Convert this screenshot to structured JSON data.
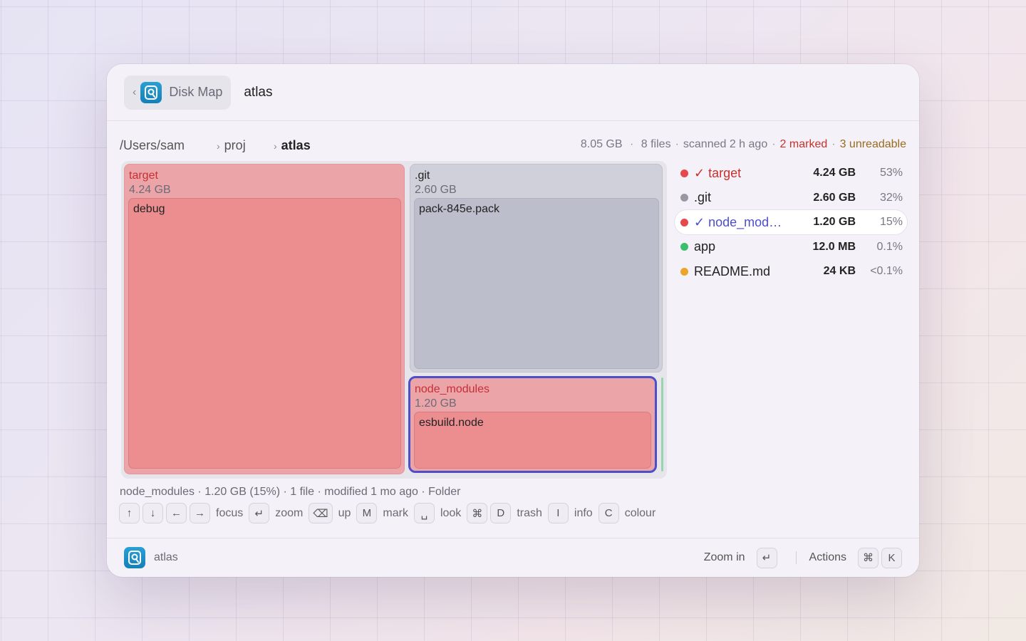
{
  "header": {
    "back_label": "Disk Map",
    "title": "atlas"
  },
  "breadcrumbs": [
    "/Users/sam",
    "proj",
    "atlas"
  ],
  "stats": {
    "size": "8.05 GB",
    "files": "8 files",
    "scanned": "scanned 2 h ago",
    "marked": "2 marked",
    "unreadable": "3 unreadable"
  },
  "treemap": {
    "target": {
      "name": "target",
      "size": "4.24 GB",
      "child": "debug"
    },
    "git": {
      "name": ".git",
      "size": "2.60 GB",
      "child": "pack-845e.pack"
    },
    "node_modules": {
      "name": "node_modules",
      "size": "1.20 GB",
      "child": "esbuild.node"
    }
  },
  "list": [
    {
      "name": "✓ target",
      "size": "4.24 GB",
      "pct": "53%",
      "dot": "#e5484d"
    },
    {
      "name": ".git",
      "size": "2.60 GB",
      "pct": "32%",
      "dot": "#9a98a3"
    },
    {
      "name": "✓ node_mod…",
      "size": "1.20 GB",
      "pct": "15%",
      "dot": "#e5484d"
    },
    {
      "name": "app",
      "size": "12.0 MB",
      "pct": "0.1%",
      "dot": "#3cbf6b"
    },
    {
      "name": "README.md",
      "size": "24 KB",
      "pct": "<0.1%",
      "dot": "#eba52b"
    }
  ],
  "info_line": "node_modules · 1.20 GB (15%) · 1 file · modified 1 mo ago · Folder",
  "shortcuts": {
    "up_arrow": "↑",
    "down_arrow": "↓",
    "left_arrow": "←",
    "right_arrow": "→",
    "focus": "focus",
    "enter": "↵",
    "zoom": "zoom",
    "backspace": "⌫",
    "up": "up",
    "m": "M",
    "mark": "mark",
    "space": "␣",
    "look": "look",
    "cmd": "⌘",
    "d": "D",
    "trash": "trash",
    "i": "I",
    "info": "info",
    "c": "C",
    "colour": "colour"
  },
  "footer": {
    "app_name": "atlas",
    "zoom_in": "Zoom in",
    "enter": "↵",
    "actions": "Actions",
    "cmd": "⌘",
    "k": "K"
  }
}
